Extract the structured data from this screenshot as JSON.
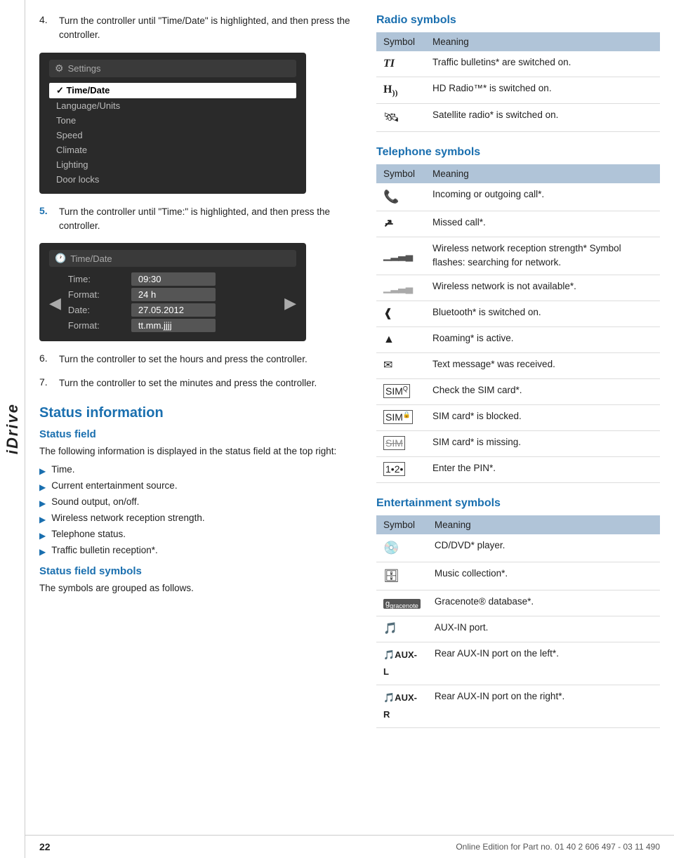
{
  "sidebar": {
    "label": "iDrive"
  },
  "steps": [
    {
      "num": "4.",
      "numStyle": "normal",
      "text": "Turn the controller until \"Time/Date\" is highlighted, and then press the controller."
    },
    {
      "num": "5.",
      "numStyle": "blue",
      "text": "Turn the controller until \"Time:\" is highlighted, and then press the controller."
    },
    {
      "num": "6.",
      "numStyle": "normal",
      "text": "Turn the controller to set the hours and press the controller."
    },
    {
      "num": "7.",
      "numStyle": "normal",
      "text": "Turn the controller to set the minutes and press the controller."
    }
  ],
  "screenshot1": {
    "title": "Settings",
    "items": [
      "✓ Time/Date",
      "Language/Units",
      "Tone",
      "Speed",
      "Climate",
      "Lighting",
      "Door locks"
    ],
    "selectedIndex": 0
  },
  "screenshot2": {
    "title": "Time/Date",
    "rows": [
      {
        "label": "Time:",
        "value": "09:30"
      },
      {
        "label": "Format:",
        "value": "24 h"
      },
      {
        "label": "Date:",
        "value": "27.05.2012"
      },
      {
        "label": "Format:",
        "value": "tt.mm.jjjj"
      }
    ]
  },
  "status_information": {
    "section_title": "Status information",
    "status_field": {
      "title": "Status field",
      "body": "The following information is displayed in the status field at the top right:",
      "bullets": [
        "Time.",
        "Current entertainment source.",
        "Sound output, on/off.",
        "Wireless network reception strength.",
        "Telephone status.",
        "Traffic bulletin reception*."
      ]
    },
    "status_field_symbols": {
      "title": "Status field symbols",
      "body": "The symbols are grouped as follows."
    }
  },
  "radio_symbols": {
    "title": "Radio symbols",
    "col_symbol": "Symbol",
    "col_meaning": "Meaning",
    "rows": [
      {
        "symbol": "TI",
        "meaning": "Traffic bulletins* are switched on."
      },
      {
        "symbol": "H))) ",
        "meaning": "HD Radio™* is switched on."
      },
      {
        "symbol": "🛰",
        "meaning": "Satellite radio* is switched on."
      }
    ]
  },
  "telephone_symbols": {
    "title": "Telephone symbols",
    "col_symbol": "Symbol",
    "col_meaning": "Meaning",
    "rows": [
      {
        "symbol": "📞",
        "meaning": "Incoming or outgoing call*."
      },
      {
        "symbol": "↗",
        "meaning": "Missed call*."
      },
      {
        "symbol": "📶",
        "meaning": "Wireless network reception strength* Symbol flashes: searching for network."
      },
      {
        "symbol": "📵",
        "meaning": "Wireless network is not available*."
      },
      {
        "symbol": "🔵",
        "meaning": "Bluetooth* is switched on."
      },
      {
        "symbol": "▲",
        "meaning": "Roaming* is active."
      },
      {
        "symbol": "✉",
        "meaning": "Text message* was received."
      },
      {
        "symbol": "📋",
        "meaning": "Check the SIM card*."
      },
      {
        "symbol": "🔒",
        "meaning": "SIM card* is blocked."
      },
      {
        "symbol": "🚫",
        "meaning": "SIM card* is missing."
      },
      {
        "symbol": "🔢",
        "meaning": "Enter the PIN*."
      }
    ]
  },
  "entertainment_symbols": {
    "title": "Entertainment symbols",
    "col_symbol": "Symbol",
    "col_meaning": "Meaning",
    "rows": [
      {
        "symbol": "💿",
        "meaning": "CD/DVD* player."
      },
      {
        "symbol": "💾",
        "meaning": "Music collection*."
      },
      {
        "symbol": "g gracenote",
        "meaning": "Gracenote® database*."
      },
      {
        "symbol": "🎵",
        "meaning": "AUX-IN port."
      },
      {
        "symbol": "🎵AUX-L",
        "meaning": "Rear AUX-IN port on the left*."
      },
      {
        "symbol": "🎵AUX-R",
        "meaning": "Rear AUX-IN port on the right*."
      }
    ]
  },
  "footer": {
    "page": "22",
    "note": "Online Edition for Part no. 01 40 2 606 497 - 03 11 490"
  }
}
